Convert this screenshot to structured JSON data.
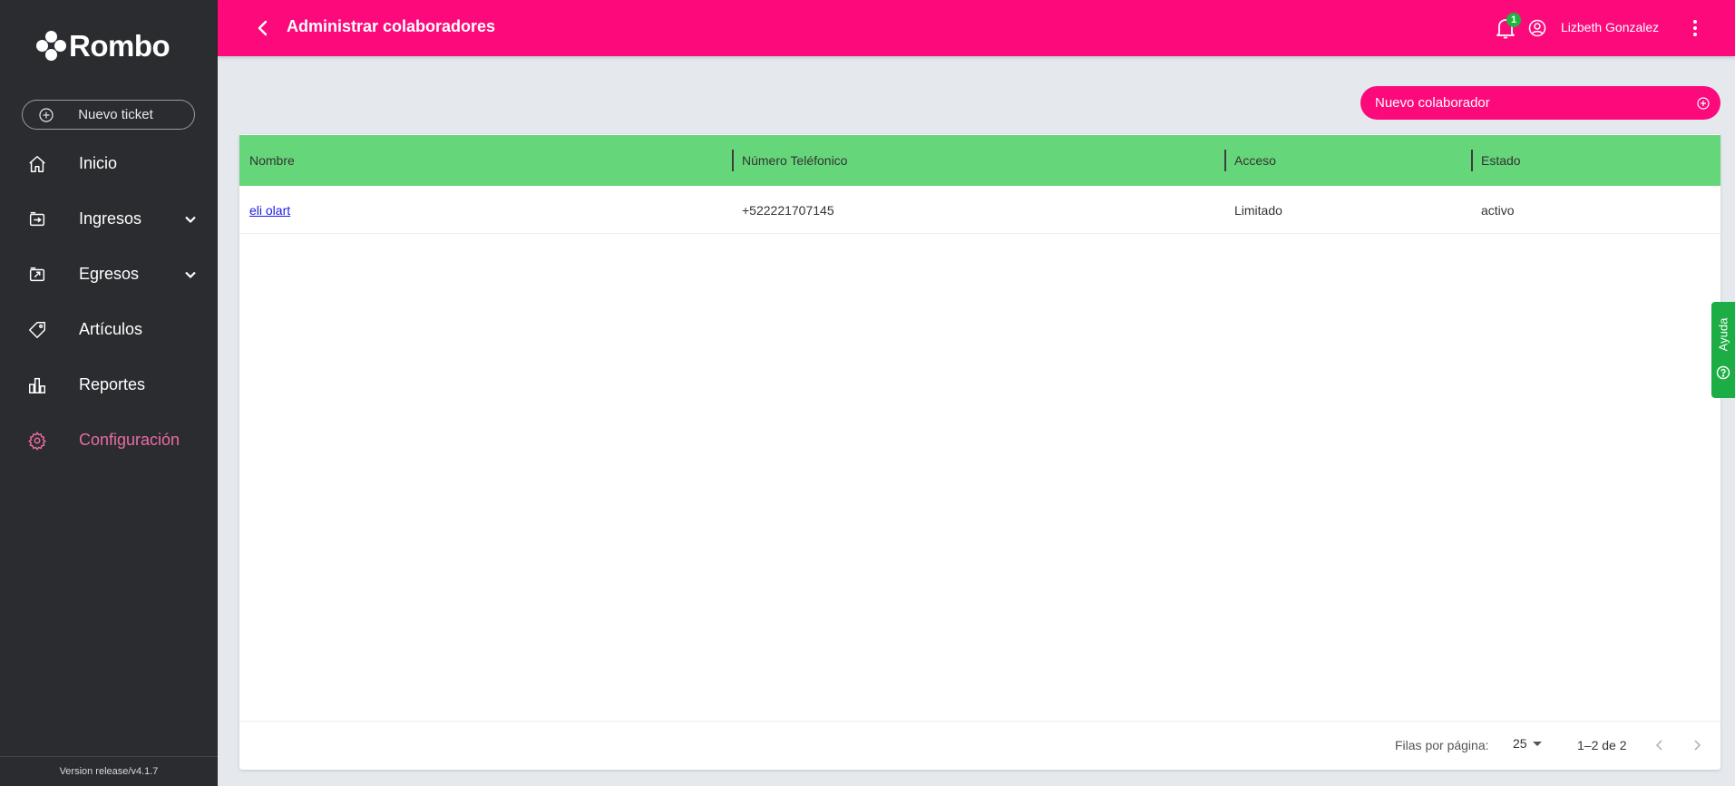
{
  "app": {
    "logo_text": "Rombo",
    "version": "Version release/v4.1.7"
  },
  "sidebar": {
    "new_ticket_label": "Nuevo ticket",
    "items": [
      {
        "label": "Inicio",
        "icon": "home-icon",
        "expandable": false,
        "active": false
      },
      {
        "label": "Ingresos",
        "icon": "income-icon",
        "expandable": true,
        "active": false
      },
      {
        "label": "Egresos",
        "icon": "expense-icon",
        "expandable": true,
        "active": false
      },
      {
        "label": "Artículos",
        "icon": "tag-icon",
        "expandable": false,
        "active": false
      },
      {
        "label": "Reportes",
        "icon": "bar-chart-icon",
        "expandable": false,
        "active": false
      },
      {
        "label": "Configuración",
        "icon": "gear-icon",
        "expandable": false,
        "active": true
      }
    ]
  },
  "header": {
    "title": "Administrar colaboradores",
    "notification_count": "1",
    "user_name": "Lizbeth Gonzalez"
  },
  "actions": {
    "new_collaborator_label": "Nuevo colaborador"
  },
  "table": {
    "columns": [
      "Nombre",
      "Número Teléfonico",
      "Acceso",
      "Estado"
    ],
    "rows": [
      {
        "nombre": "eli olart",
        "telefono": "+522221707145",
        "acceso": "Limitado",
        "estado": "activo"
      }
    ]
  },
  "pagination": {
    "rows_per_page_label": "Filas por página:",
    "rows_per_page_value": "25",
    "range_label": "1–2 de 2"
  },
  "help": {
    "label": "Ayuda"
  },
  "colors": {
    "brand_pink": "#fc0a7c",
    "header_green": "#66d67a",
    "help_green": "#1cae44",
    "sidebar_bg": "#2b2c30",
    "active_nav": "#ea6ba4"
  }
}
